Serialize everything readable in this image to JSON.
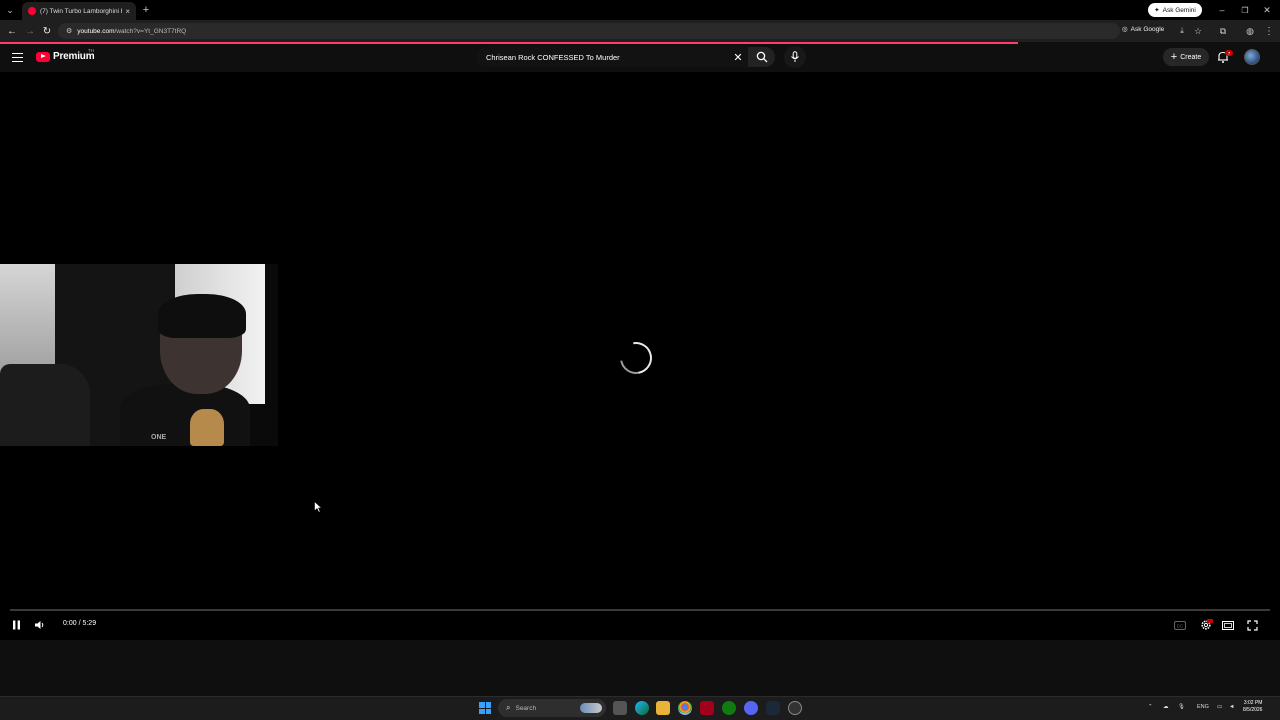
{
  "browser": {
    "tab_title": "(7) Twin Turbo Lamborghini Hu",
    "tab_close": "×",
    "new_tab": "+",
    "ask_gemini": "Ask Gemini",
    "url_host": "youtube.com",
    "url_path": "/watch?v=Yt_GN3T7tRQ",
    "ask_google": "Ask Google"
  },
  "youtube": {
    "logo_text": "Premium",
    "logo_sup": "TH",
    "search_query": "Chrisean Rock CONFESSED To Murder",
    "create_label": "Create",
    "notification_count": "7"
  },
  "player": {
    "time_display": "0:00 / 5:29",
    "progress_fraction": 0.0,
    "webcam_shirt_text": "ONE"
  },
  "taskbar": {
    "search_placeholder": "Search",
    "language": "ENG",
    "time": "3:02 PM",
    "date": "8/5/2026"
  },
  "colors": {
    "youtube_red": "#ff0033",
    "loading_bar": "#ff3d6b",
    "background": "#0f0f0f"
  }
}
